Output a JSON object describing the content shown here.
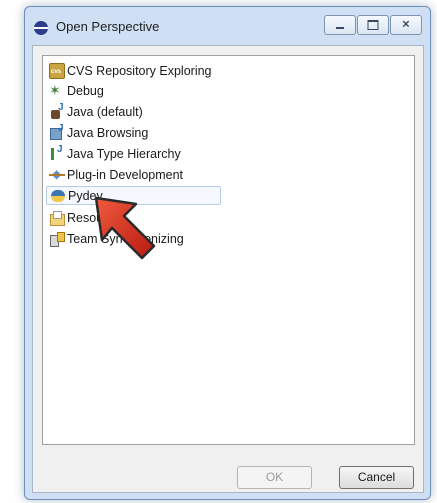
{
  "window": {
    "title": "Open Perspective",
    "icon": "eclipse-icon"
  },
  "perspectives": [
    {
      "label": "CVS Repository Exploring",
      "icon": "cvs-icon"
    },
    {
      "label": "Debug",
      "icon": "debug-icon"
    },
    {
      "label": "Java (default)",
      "icon": "java-icon"
    },
    {
      "label": "Java Browsing",
      "icon": "java-browsing-icon"
    },
    {
      "label": "Java Type Hierarchy",
      "icon": "type-hierarchy-icon"
    },
    {
      "label": "Plug-in Development",
      "icon": "plugin-icon"
    },
    {
      "label": "Pydev",
      "icon": "python-icon",
      "selected": true
    },
    {
      "label": "Resou",
      "icon": "resource-icon"
    },
    {
      "label": "Team Syn     ronizing",
      "icon": "team-sync-icon"
    }
  ],
  "buttons": {
    "ok": {
      "label": "OK",
      "enabled": false
    },
    "cancel": {
      "label": "Cancel",
      "enabled": true
    }
  },
  "overlay": {
    "icon": "red-pointer-arrow-icon",
    "color": "#d8281c"
  }
}
